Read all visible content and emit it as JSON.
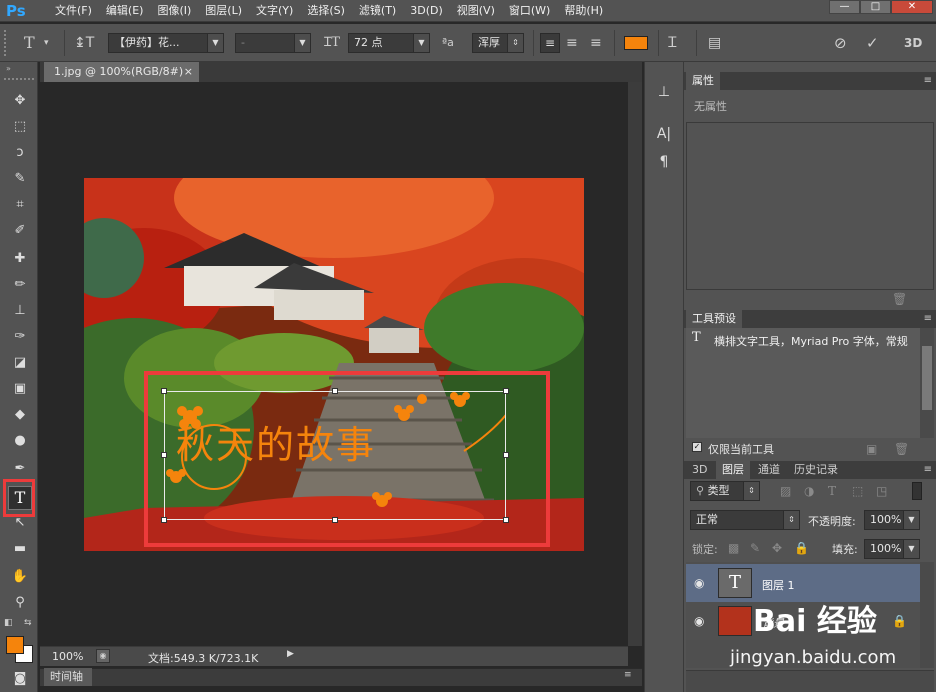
{
  "app": {
    "logo": "Ps",
    "menu": [
      "文件(F)",
      "编辑(E)",
      "图像(I)",
      "图层(L)",
      "文字(Y)",
      "选择(S)",
      "滤镜(T)",
      "3D(D)",
      "视图(V)",
      "窗口(W)",
      "帮助(H)"
    ],
    "window_buttons": [
      "—",
      "□",
      "✕"
    ]
  },
  "options": {
    "font_family": "【伊药】花...",
    "font_style": "-",
    "font_size": "72 点",
    "aa_label": "ªa",
    "anti_alias": "浑厚",
    "text_color": "#f5840c"
  },
  "document": {
    "tab_title": "1.jpg @ 100%(RGB/8#)",
    "tab_close": "×",
    "zoom": "100%",
    "doc_info": "文档:549.3 K/723.1K",
    "timeline_tab": "时间轴"
  },
  "artwork": {
    "text_layer_content": "秋天的故事"
  },
  "panels": {
    "properties": {
      "tab": "属性",
      "content": "无属性"
    },
    "tool_presets": {
      "tab": "工具预设",
      "item": "横排文字工具，Myriad Pro 字体，常规",
      "current_tool_only": "仅限当前工具"
    },
    "layers": {
      "tabs": [
        "3D",
        "图层",
        "通道",
        "历史记录"
      ],
      "filter_kind": "类型",
      "blend_mode": "正常",
      "opacity_label": "不透明度:",
      "opacity": "100%",
      "lock_label": "锁定:",
      "fill_label": "填充:",
      "fill": "100%",
      "items": [
        {
          "name": "图层 1",
          "kind": "text"
        },
        {
          "name": "背景",
          "kind": "image"
        }
      ]
    }
  },
  "watermark": {
    "logo": "Bai 经验",
    "url": "jingyan.baidu.com"
  },
  "colors": {
    "accent_orange": "#f5840c",
    "highlight_red": "#ed3b3b",
    "ui_gray": "#535353",
    "canvas_bg": "#282828"
  }
}
